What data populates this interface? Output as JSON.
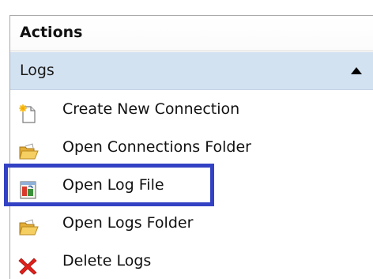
{
  "panel": {
    "title": "Actions"
  },
  "group": {
    "title": "Logs",
    "collapse_icon": "triangle-up-icon"
  },
  "items": [
    {
      "label": "Create New Connection",
      "icon": "new-document-icon"
    },
    {
      "label": "Open Connections Folder",
      "icon": "open-folder-icon"
    },
    {
      "label": "Open Log File",
      "icon": "log-file-icon"
    },
    {
      "label": "Open Logs Folder",
      "icon": "open-folder-icon"
    },
    {
      "label": "Delete Logs",
      "icon": "red-x-delete-icon"
    }
  ],
  "colors": {
    "group_header_bg": "#d3e2f1",
    "highlight_border": "#3342c4",
    "delete_red": "#e0201b",
    "folder_yellow": "#f3c451"
  }
}
